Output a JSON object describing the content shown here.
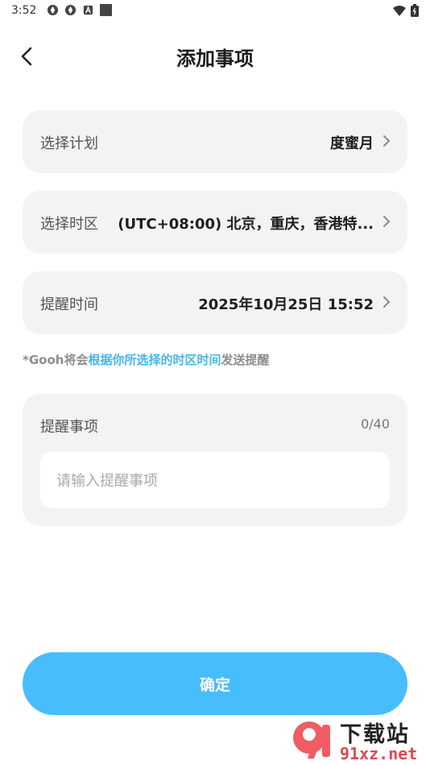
{
  "status_bar": {
    "time": "3:52",
    "icons": [
      "app-icon-1",
      "app-icon-2",
      "a-icon",
      "square-icon"
    ],
    "right_icons": [
      "wifi-icon",
      "battery-icon"
    ]
  },
  "header": {
    "title": "添加事项",
    "back_icon": "back-arrow-icon"
  },
  "rows": [
    {
      "label": "选择计划",
      "value": "度蜜月"
    },
    {
      "label": "选择时区",
      "value": "(UTC+08:00) 北京，重庆，香港特..."
    },
    {
      "label": "提醒时间",
      "value": "2025年10月25日 15:52"
    }
  ],
  "hint": {
    "prefix": "*Gooh将会",
    "highlight": "根据你所选择的时区时间",
    "suffix": "发送提醒"
  },
  "remark": {
    "label": "提醒事项",
    "count": "0/40",
    "placeholder": "请输入提醒事项"
  },
  "confirm_label": "确定",
  "watermark": {
    "title": "下载站",
    "url": "91xz.net"
  },
  "colors": {
    "accent": "#48bdfb",
    "hint_highlight": "#48b4ee",
    "card_bg": "#f3f3f3"
  }
}
